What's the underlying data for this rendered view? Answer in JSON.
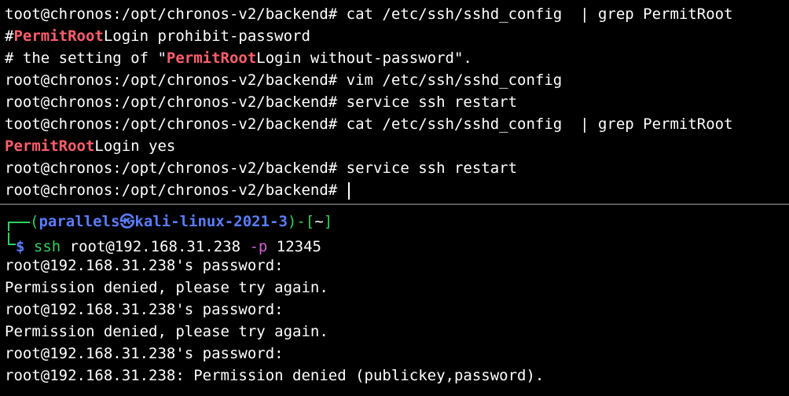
{
  "top_pane": {
    "lines": [
      {
        "t": "toot@chronos:/opt/chronos-v2/backend# cat /etc/ssh/sshd_config  | grep PermitRoot"
      },
      {
        "pre": "#",
        "hl": "PermitRoot",
        "post": "Login prohibit-password"
      },
      {
        "pre": "# the setting of \"",
        "hl": "PermitRoot",
        "post": "Login without-password\"."
      },
      {
        "t": "root@chronos:/opt/chronos-v2/backend# vim /etc/ssh/sshd_config"
      },
      {
        "t": "root@chronos:/opt/chronos-v2/backend# service ssh restart"
      },
      {
        "t": "toot@chronos:/opt/chronos-v2/backend# cat /etc/ssh/sshd_config  | grep PermitRoot"
      },
      {
        "hl": "PermitRoot",
        "post": "Login yes"
      },
      {
        "t": "root@chronos:/opt/chronos-v2/backend# service ssh restart"
      },
      {
        "t": "root@chronos:/opt/chronos-v2/backend# "
      }
    ]
  },
  "bottom_pane": {
    "prompt": {
      "open": "(",
      "user": "parallels",
      "at": "㉿",
      "host": "kali-linux-2021-3",
      "close": ")",
      "sep": "-[",
      "dir": "~",
      "end": "]",
      "dollar": "$",
      "cmd": "ssh",
      "args": " root@192.168.31.238 ",
      "flag": "-p",
      "port": " 12345"
    },
    "output": [
      "root@192.168.31.238's password:",
      "Permission denied, please try again.",
      "root@192.168.31.238's password:",
      "Permission denied, please try again.",
      "root@192.168.31.238's password:",
      "root@192.168.31.238: Permission denied (publickey,password)."
    ]
  },
  "colors": {
    "background": "#000000",
    "text": "#ffffff",
    "highlight": "#ff5f6b",
    "prompt_green": "#2fd25c",
    "prompt_blue": "#5a7dff",
    "flag_magenta": "#d75fd7"
  }
}
